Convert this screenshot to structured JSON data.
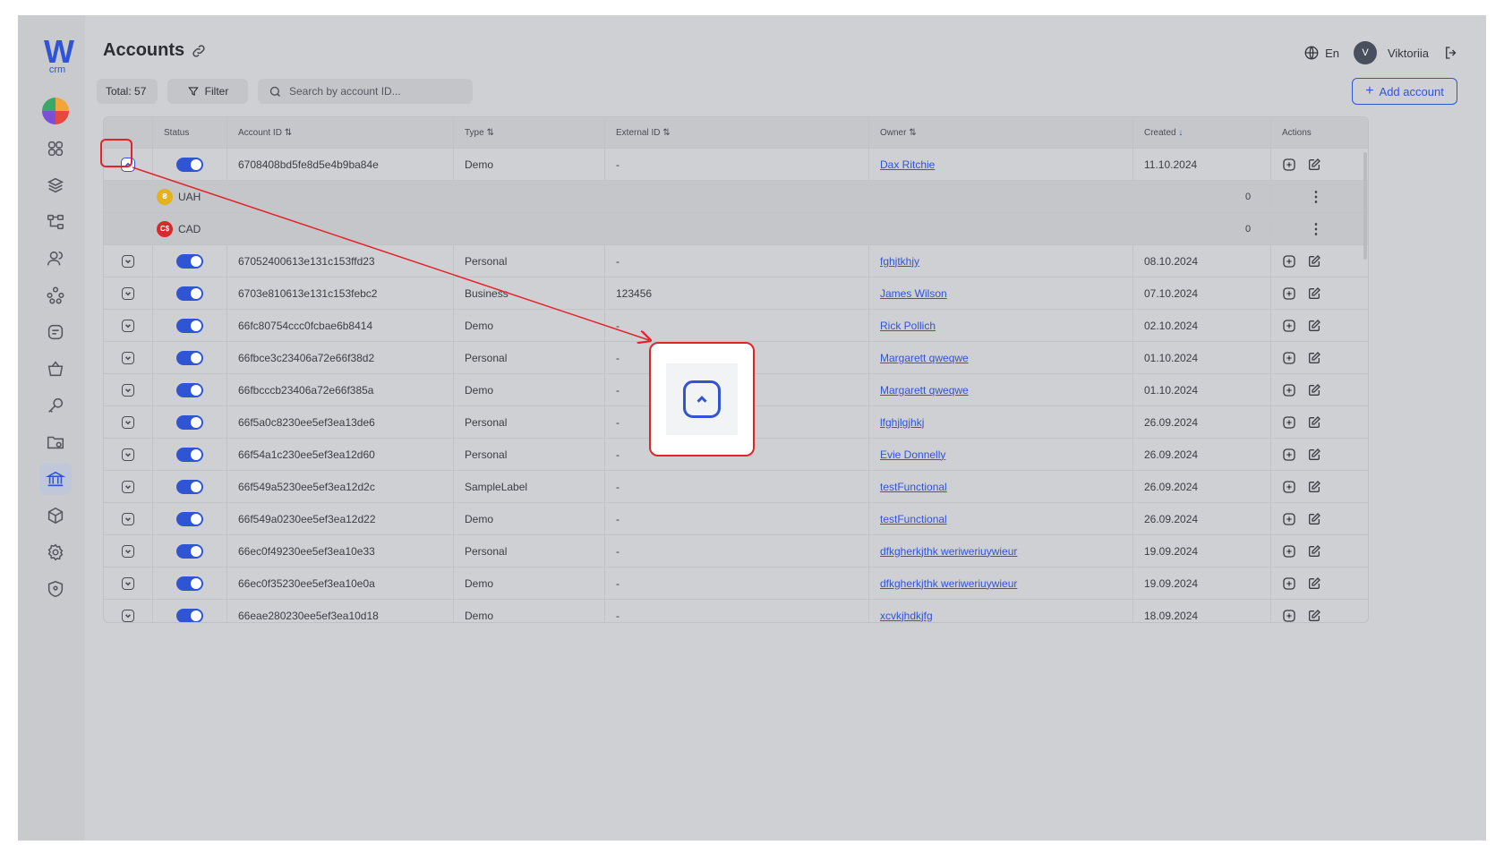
{
  "app": {
    "logo_text": "W",
    "logo_sub": "crm"
  },
  "header": {
    "title": "Accounts",
    "language": "En",
    "user_initial": "V",
    "user_name": "Viktoriia"
  },
  "toolbar": {
    "total_label": "Total: 57",
    "filter_label": "Filter",
    "search_placeholder": "Search by account ID...",
    "add_label": "Add account"
  },
  "sidebar": {
    "items": [
      "dashboard-icon",
      "layers-icon",
      "hierarchy-icon",
      "users-icon",
      "network-icon",
      "tasks-icon",
      "basket-icon",
      "key-icon",
      "folder-icon",
      "bank-icon",
      "cube-icon",
      "settings-icon",
      "shield-icon"
    ],
    "active_item": "bank-icon"
  },
  "table": {
    "columns": [
      "Status",
      "Account ID",
      "Type",
      "External ID",
      "Owner",
      "Created",
      "Actions"
    ],
    "sort_indicators": {
      "account_id": "⇅",
      "type": "⇅",
      "external_id": "⇅",
      "owner": "⇅",
      "created": "↓"
    },
    "expanded_row": {
      "account_id": "6708408bd5fe8d5e4b9ba84e",
      "type": "Demo",
      "external_id": "-",
      "owner": "Dax Ritchie",
      "created": "11.10.2024",
      "currencies": [
        {
          "code": "UAH",
          "symbol": "₴",
          "color": "#e3b21e",
          "value": "0"
        },
        {
          "code": "CAD",
          "symbol": "C$",
          "color": "#d52b2b",
          "value": "0"
        }
      ]
    },
    "rows": [
      {
        "account_id": "67052400613e131c153ffd23",
        "type": "Personal",
        "external_id": "-",
        "owner": "fghjtkhjy",
        "created": "08.10.2024"
      },
      {
        "account_id": "6703e810613e131c153febc2",
        "type": "Business",
        "external_id": "123456",
        "owner": "James Wilson",
        "created": "07.10.2024"
      },
      {
        "account_id": "66fc80754ccc0fcbae6b8414",
        "type": "Demo",
        "external_id": "-",
        "owner": "Rick Pollich",
        "created": "02.10.2024"
      },
      {
        "account_id": "66fbce3c23406a72e66f38d2",
        "type": "Personal",
        "external_id": "-",
        "owner": "Margarett qweqwe",
        "created": "01.10.2024"
      },
      {
        "account_id": "66fbcccb23406a72e66f385a",
        "type": "Demo",
        "external_id": "-",
        "owner": "Margarett qweqwe",
        "created": "01.10.2024"
      },
      {
        "account_id": "66f5a0c8230ee5ef3ea13de6",
        "type": "Personal",
        "external_id": "-",
        "owner": "lfghjlgjhkj",
        "created": "26.09.2024"
      },
      {
        "account_id": "66f54a1c230ee5ef3ea12d60",
        "type": "Personal",
        "external_id": "-",
        "owner": "Evie Donnelly",
        "created": "26.09.2024"
      },
      {
        "account_id": "66f549a5230ee5ef3ea12d2c",
        "type": "SampleLabel",
        "external_id": "-",
        "owner": "testFunctional",
        "created": "26.09.2024"
      },
      {
        "account_id": "66f549a0230ee5ef3ea12d22",
        "type": "Demo",
        "external_id": "-",
        "owner": "testFunctional",
        "created": "26.09.2024"
      },
      {
        "account_id": "66ec0f49230ee5ef3ea10e33",
        "type": "Personal",
        "external_id": "-",
        "owner": "dfkgherkjthk weriweriuywieur",
        "created": "19.09.2024"
      },
      {
        "account_id": "66ec0f35230ee5ef3ea10e0a",
        "type": "Demo",
        "external_id": "-",
        "owner": "dfkgherkjthk weriweriuywieur",
        "created": "19.09.2024"
      },
      {
        "account_id": "66eae280230ee5ef3ea10d18",
        "type": "Demo",
        "external_id": "-",
        "owner": "xcvkjhdkjfg",
        "created": "18.09.2024"
      }
    ]
  },
  "colors": {
    "accent": "#2f55d4",
    "annotation": "#e0242a"
  }
}
